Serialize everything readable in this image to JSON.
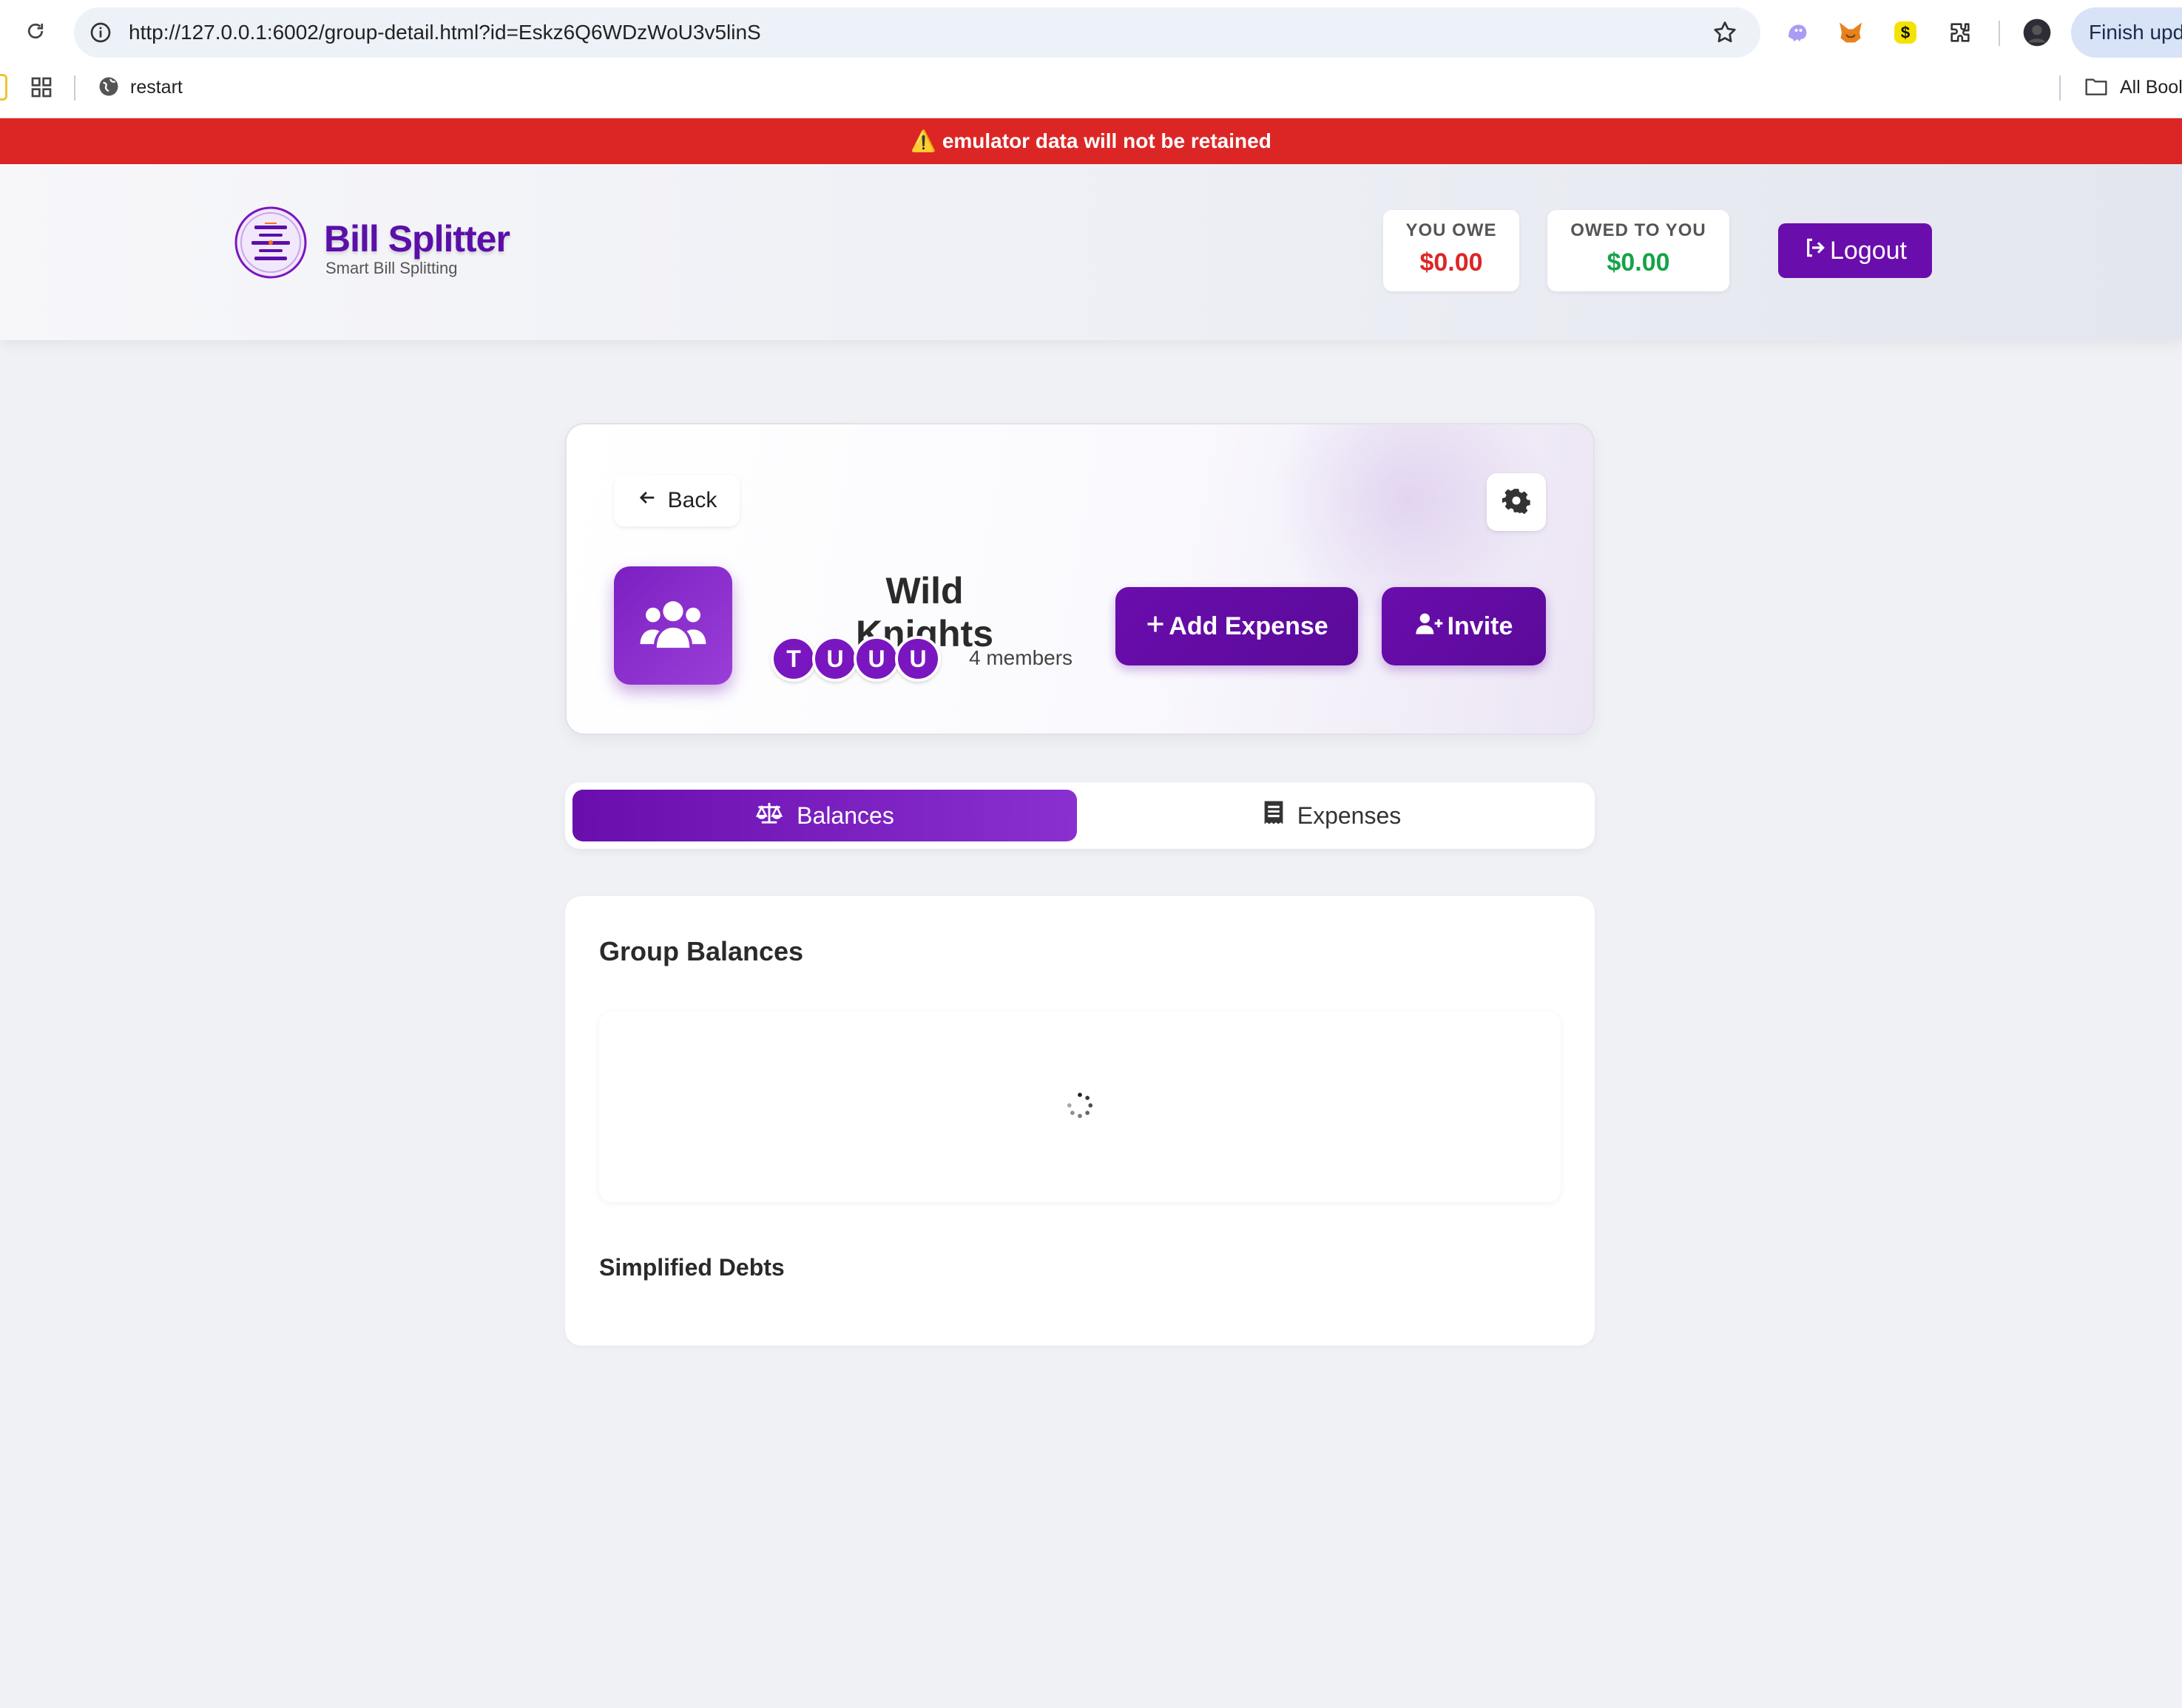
{
  "browser": {
    "url": "http://127.0.0.1:6002/group-detail.html?id=Eskz6Q6WDzWoU3v5linS",
    "finish_update_label": "Finish upd",
    "bookmarks": [
      {
        "label": "restart"
      }
    ],
    "all_bookmarks_label": "All Bool"
  },
  "banner": {
    "text": "⚠️ emulator data will not be retained",
    "color": "#dc2626"
  },
  "header": {
    "brand_title": "Bill Splitter",
    "brand_subtitle": "Smart Bill Splitting",
    "you_owe": {
      "label": "YOU OWE",
      "value": "$0.00",
      "color": "#dc2626"
    },
    "owed_to_you": {
      "label": "OWED TO YOU",
      "value": "$0.00",
      "color": "#16a34a"
    },
    "logout_label": "Logout",
    "accent": "#6a0dad"
  },
  "group": {
    "back_label": "Back",
    "name": "Wild Knights",
    "member_initials": [
      "T",
      "U",
      "U",
      "U"
    ],
    "members_count": "4 members",
    "add_expense_label": "Add Expense",
    "invite_label": "Invite",
    "settings_icon": "gear-icon",
    "avatar_icon": "users-icon"
  },
  "tabs": [
    {
      "label": "Balances",
      "icon": "scale-icon",
      "active": true
    },
    {
      "label": "Expenses",
      "icon": "receipt-icon",
      "active": false
    }
  ],
  "balances": {
    "title": "Group Balances",
    "loading": true,
    "simplified_title": "Simplified Debts"
  }
}
